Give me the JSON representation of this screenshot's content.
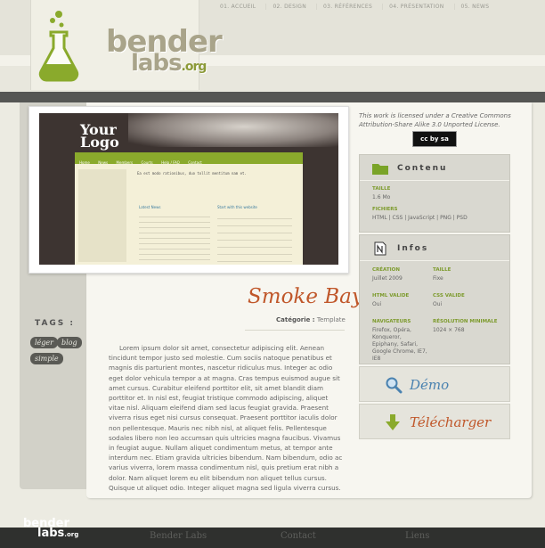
{
  "header": {
    "logo_word1": "bender",
    "logo_word2": "labs",
    "logo_tld": ".org",
    "nav": [
      "01. ACCUEIL",
      "02. DESIGN",
      "03. RÉFÉRENCES",
      "04. PRÉSENTATION",
      "05. NEWS"
    ]
  },
  "preview": {
    "logo": "Your Logo",
    "nav": [
      "Home",
      "News",
      "Members",
      "Courts",
      "Help / FAQ",
      "Contact"
    ],
    "heading": "Ea est modo rationibus, duo tollit mentitum nam et.",
    "latest_news": "Latest News",
    "start_with": "Start with this website"
  },
  "project": {
    "title": "Smoke Bay",
    "category_label": "Catégorie :",
    "category_value": "Template",
    "description": "Lorem ipsum dolor sit amet, consectetur adipiscing elit. Aenean tincidunt tempor justo sed molestie. Cum sociis natoque penatibus et magnis dis parturient montes, nascetur ridiculus mus. Integer ac odio eget dolor vehicula tempor a at magna. Cras tempus euismod augue sit amet cursus. Curabitur eleifend porttitor elit, sit amet blandit diam porttitor et. In nisl est, feugiat tristique commodo adipiscing, aliquet vitae nisl. Aliquam eleifend diam sed lacus feugiat gravida. Praesent viverra risus eget nisi cursus consequat. Praesent porttitor iaculis dolor non pellentesque. Mauris nec nibh nisl, at aliquet felis. Pellentesque sodales libero non leo accumsan quis ultricies magna faucibus. Vivamus in feugiat augue. Nullam aliquet condimentum metus, at tempor ante interdum nec. Etiam gravida ultricies bibendum. Nam bibendum, odio ac varius viverra, lorem massa condimentum nisl, quis pretium erat nibh a dolor. Nam aliquet lorem eu elit bibendum non aliquet tellus cursus. Quisque ut aliquet odio. Integer aliquet magna sed ligula viverra cursus."
  },
  "tags": {
    "title": "TAGS :",
    "items": [
      "léger",
      "blog",
      "simple"
    ]
  },
  "license": {
    "text": "This work is licensed under a Creative Commons Attribution-Share Alike 3.0 Unported License.",
    "badge": "cc by sa"
  },
  "contenu": {
    "title": "Contenu",
    "size_label": "TAILLE",
    "size_value": "1.6 Mo",
    "files_label": "FICHIERS",
    "files_value": "HTML | CSS | JavaScript | PNG | PSD"
  },
  "infos": {
    "title": "Infos",
    "creation_label": "CRÉATION",
    "creation_value": "Juillet 2009",
    "taille_label": "TAILLE",
    "taille_value": "Fixe",
    "html_label": "HTML VALIDE",
    "html_value": "Oui",
    "css_label": "CSS VALIDE",
    "css_value": "Oui",
    "nav_label": "NAVIGATEURS",
    "nav_value": "Firefox, Opéra, Konqueror, Epiphany, Safari, Google Chrome, IE7, IE8",
    "res_label": "RÉSOLUTION MINIMALE",
    "res_value": "1024 × 768"
  },
  "actions": {
    "demo": "Démo",
    "download": "Télécharger"
  },
  "footer": {
    "logo_word1": "bender",
    "logo_word2": "labs",
    "logo_tld": ".org",
    "links": [
      "Bender Labs",
      "Contact",
      "Liens"
    ]
  },
  "colors": {
    "accent_green": "#8aaa2c",
    "title_orange": "#c0572a",
    "demo_blue": "#4a82b0"
  }
}
